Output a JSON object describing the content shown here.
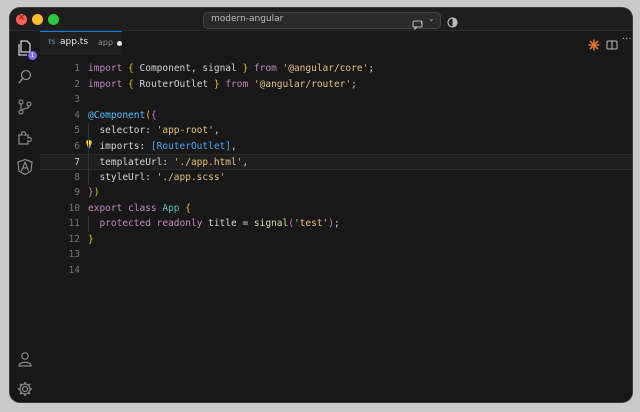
{
  "window": {
    "search_text": "modern-angular"
  },
  "activity_bar": {
    "badge_count": "1",
    "icons": [
      "explorer-icon",
      "search-icon",
      "source-control-icon",
      "extensions-icon",
      "angular-icon",
      "account-icon",
      "settings-gear-icon"
    ]
  },
  "tab": {
    "file_type": "TS",
    "name": "app.ts",
    "description": "app"
  },
  "editor": {
    "current_line": 7,
    "lines": [
      {
        "n": "1",
        "tokens": [
          [
            "kw",
            "import "
          ],
          [
            "br",
            "{ "
          ],
          [
            "id",
            "Component, signal "
          ],
          [
            "br",
            "}"
          ],
          [
            "kw",
            " from "
          ],
          [
            "str2",
            "'@angular/core'"
          ],
          [
            "id",
            ";"
          ]
        ]
      },
      {
        "n": "2",
        "tokens": [
          [
            "kw",
            "import "
          ],
          [
            "br",
            "{ "
          ],
          [
            "id",
            "RouterOutlet "
          ],
          [
            "br",
            "}"
          ],
          [
            "kw",
            " from "
          ],
          [
            "str2",
            "'@angular/router'"
          ],
          [
            "id",
            ";"
          ]
        ]
      },
      {
        "n": "3",
        "tokens": []
      },
      {
        "n": "4",
        "tokens": [
          [
            "dec",
            "@Component"
          ],
          [
            "br",
            "("
          ],
          [
            "br2",
            "{"
          ]
        ]
      },
      {
        "n": "5",
        "tokens": [
          [
            "prop",
            "  selector: "
          ],
          [
            "str2",
            "'app-root'"
          ],
          [
            "id",
            ","
          ]
        ]
      },
      {
        "n": "6",
        "tokens": [
          [
            "prop",
            "  imports: "
          ],
          [
            "br3",
            "[RouterOutlet]"
          ],
          [
            "id",
            ","
          ]
        ]
      },
      {
        "n": "7",
        "tokens": [
          [
            "prop",
            "  templateUrl: "
          ],
          [
            "str2",
            "'./app.html'"
          ],
          [
            "id",
            ","
          ]
        ]
      },
      {
        "n": "8",
        "tokens": [
          [
            "prop",
            "  styleUrl: "
          ],
          [
            "str2",
            "'./app.scss'"
          ]
        ]
      },
      {
        "n": "9",
        "tokens": [
          [
            "br2",
            "}"
          ],
          [
            "br",
            ")"
          ]
        ]
      },
      {
        "n": "10",
        "tokens": [
          [
            "kw",
            "export class "
          ],
          [
            "cls",
            "App "
          ],
          [
            "br",
            "{"
          ]
        ]
      },
      {
        "n": "11",
        "tokens": [
          [
            "kw",
            "  protected readonly "
          ],
          [
            "id",
            "title "
          ],
          [
            "id",
            "= "
          ],
          [
            "fn",
            "signal"
          ],
          [
            "br2",
            "("
          ],
          [
            "str2",
            "'test'"
          ],
          [
            "br2",
            ")"
          ],
          [
            "id",
            ";"
          ]
        ]
      },
      {
        "n": "12",
        "tokens": [
          [
            "br",
            "}"
          ]
        ]
      },
      {
        "n": "13",
        "tokens": []
      },
      {
        "n": "14",
        "tokens": []
      }
    ]
  }
}
